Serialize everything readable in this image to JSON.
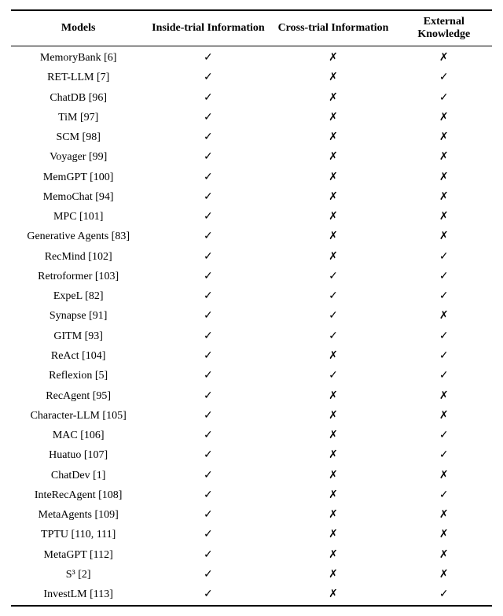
{
  "table": {
    "headers": [
      "Models",
      "Inside-trial Information",
      "Cross-trial Information",
      "External Knowledge"
    ],
    "rows": [
      {
        "model": "MemoryBank [6]",
        "inside": "✓",
        "cross": "✗",
        "external": "✗"
      },
      {
        "model": "RET-LLM [7]",
        "inside": "✓",
        "cross": "✗",
        "external": "✓"
      },
      {
        "model": "ChatDB [96]",
        "inside": "✓",
        "cross": "✗",
        "external": "✓"
      },
      {
        "model": "TiM [97]",
        "inside": "✓",
        "cross": "✗",
        "external": "✗"
      },
      {
        "model": "SCM [98]",
        "inside": "✓",
        "cross": "✗",
        "external": "✗"
      },
      {
        "model": "Voyager [99]",
        "inside": "✓",
        "cross": "✗",
        "external": "✗"
      },
      {
        "model": "MemGPT [100]",
        "inside": "✓",
        "cross": "✗",
        "external": "✗"
      },
      {
        "model": "MemoChat [94]",
        "inside": "✓",
        "cross": "✗",
        "external": "✗"
      },
      {
        "model": "MPC [101]",
        "inside": "✓",
        "cross": "✗",
        "external": "✗"
      },
      {
        "model": "Generative Agents [83]",
        "inside": "✓",
        "cross": "✗",
        "external": "✗"
      },
      {
        "model": "RecMind [102]",
        "inside": "✓",
        "cross": "✗",
        "external": "✓"
      },
      {
        "model": "Retroformer [103]",
        "inside": "✓",
        "cross": "✓",
        "external": "✓"
      },
      {
        "model": "ExpeL [82]",
        "inside": "✓",
        "cross": "✓",
        "external": "✓"
      },
      {
        "model": "Synapse [91]",
        "inside": "✓",
        "cross": "✓",
        "external": "✗"
      },
      {
        "model": "GITM [93]",
        "inside": "✓",
        "cross": "✓",
        "external": "✓"
      },
      {
        "model": "ReAct [104]",
        "inside": "✓",
        "cross": "✗",
        "external": "✓"
      },
      {
        "model": "Reflexion [5]",
        "inside": "✓",
        "cross": "✓",
        "external": "✓"
      },
      {
        "model": "RecAgent [95]",
        "inside": "✓",
        "cross": "✗",
        "external": "✗"
      },
      {
        "model": "Character-LLM [105]",
        "inside": "✓",
        "cross": "✗",
        "external": "✗"
      },
      {
        "model": "MAC [106]",
        "inside": "✓",
        "cross": "✗",
        "external": "✓"
      },
      {
        "model": "Huatuo [107]",
        "inside": "✓",
        "cross": "✗",
        "external": "✓"
      },
      {
        "model": "ChatDev [1]",
        "inside": "✓",
        "cross": "✗",
        "external": "✗"
      },
      {
        "model": "InteRecAgent [108]",
        "inside": "✓",
        "cross": "✗",
        "external": "✓"
      },
      {
        "model": "MetaAgents [109]",
        "inside": "✓",
        "cross": "✗",
        "external": "✗"
      },
      {
        "model": "TPTU [110, 111]",
        "inside": "✓",
        "cross": "✗",
        "external": "✗"
      },
      {
        "model": "MetaGPT [112]",
        "inside": "✓",
        "cross": "✗",
        "external": "✗"
      },
      {
        "model": "S³ [2]",
        "inside": "✓",
        "cross": "✗",
        "external": "✗"
      },
      {
        "model": "InvestLM [113]",
        "inside": "✓",
        "cross": "✗",
        "external": "✓"
      }
    ]
  }
}
